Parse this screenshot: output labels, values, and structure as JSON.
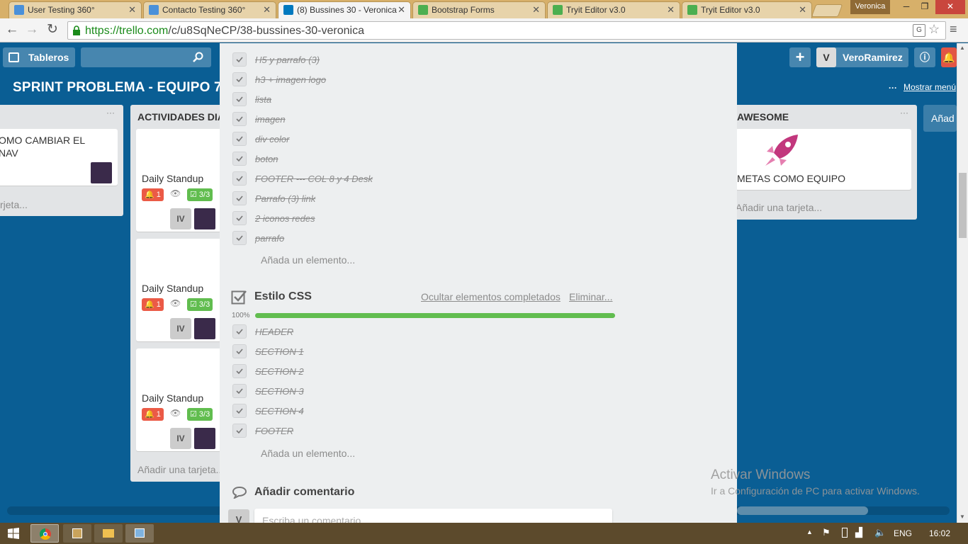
{
  "browser": {
    "tabs": [
      {
        "title": "User Testing 360°",
        "favicon_color": "#4a90d9"
      },
      {
        "title": "Contacto Testing 360°",
        "favicon_color": "#4a90d9"
      },
      {
        "title": "(8) Bussines 30 - Veronica",
        "favicon_color": "#0079bf",
        "active": true
      },
      {
        "title": "Bootstrap Forms",
        "favicon_color": "#4caf50"
      },
      {
        "title": "Tryit Editor v3.0",
        "favicon_color": "#4caf50"
      },
      {
        "title": "Tryit Editor v3.0",
        "favicon_color": "#4caf50"
      }
    ],
    "user_badge": "Veronica",
    "url_host": "https://trello.com",
    "url_path": "/c/u8SqNeCP/38-bussines-30-veronica"
  },
  "header": {
    "boards_label": "Tableros",
    "username": "VeroRamirez",
    "avatar_letter": "V",
    "board_title": "SPRINT PROBLEMA - EQUIPO 7",
    "show_menu": "Mostrar menú"
  },
  "lists": {
    "left_card_text": "OMO CAMBIAR EL NAV",
    "left_add": "rjeta...",
    "middle_title": "ACTIVIDADES DIA",
    "standup_cards": [
      {
        "title": "Daily Standup",
        "notif": "1",
        "checklist": "3/3",
        "member": "IV"
      },
      {
        "title": "Daily Standup",
        "notif": "1",
        "checklist": "3/3",
        "member": "IV"
      },
      {
        "title": "Daily Standup",
        "notif": "1",
        "checklist": "3/3",
        "member": "IV"
      }
    ],
    "middle_add": "Añadir una tarjeta...",
    "right_title": "AWESOME",
    "right_card_text": "METAS COMO EQUIPO",
    "right_add": "Añadir una tarjeta...",
    "far_right_add": "Añad"
  },
  "modal": {
    "top_items": [
      "H5 y parrafo (3)",
      "h3 + imagen logo",
      "lista",
      "imagen",
      "div color",
      "boton",
      "FOOTER --- COL 8 y 4 Desk",
      "Parrafo (3) link",
      "2 iconos redes",
      "parrafo"
    ],
    "add_element": "Añada un elemento...",
    "checklist2": {
      "title": "Estilo CSS",
      "hide_completed": "Ocultar elementos completados",
      "delete": "Eliminar...",
      "percent": "100%",
      "progress": 1.0,
      "items": [
        "HEADER",
        "SECTION 1",
        "SECTION 2",
        "SECTION 3",
        "SECTION 4",
        "FOOTER"
      ]
    },
    "comment_title": "Añadir comentario",
    "comment_placeholder": "Escriba un comentario...",
    "comment_avatar": "V"
  },
  "windows": {
    "activate_title": "Activar Windows",
    "activate_sub": "Ir a Configuración de PC para activar Windows.",
    "lang": "ENG",
    "time": "16:02"
  }
}
